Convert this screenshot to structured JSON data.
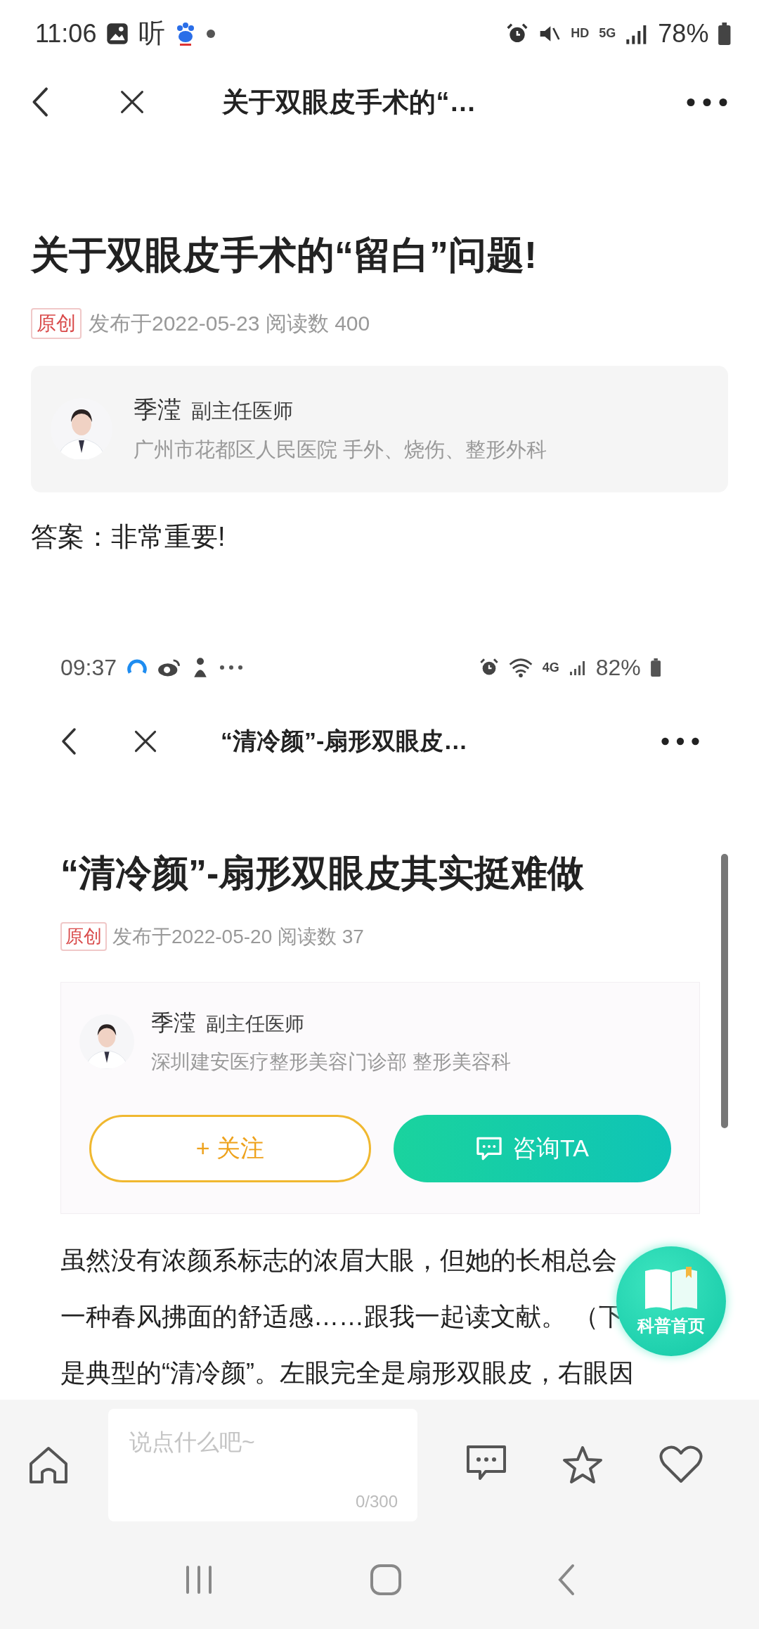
{
  "status_bar": {
    "time": "11:06",
    "app_glyph": "听",
    "network_labels": [
      "HD",
      "5G"
    ],
    "battery": "78%"
  },
  "nav": {
    "title": "关于双眼皮手术的“…"
  },
  "article": {
    "title": "关于双眼皮手术的“留白”问题!",
    "tag": "原创",
    "meta": "发布于2022-05-23 阅读数 400",
    "author": {
      "name": "季滢",
      "rank": "副主任医师",
      "hospital": "广州市花都区人民医院 手外、烧伤、整形外科"
    },
    "lead": "答案：非常重要!"
  },
  "embedded": {
    "status_bar": {
      "time": "09:37",
      "network_label": "4G",
      "battery": "82%"
    },
    "nav": {
      "title": "“清冷颜”-扇形双眼皮…"
    },
    "title": "“清冷颜”-扇形双眼皮其实挺难做",
    "tag": "原创",
    "meta": "发布于2022-05-20 阅读数 37",
    "author": {
      "name": "季滢",
      "rank": "副主任医师",
      "hospital": "深圳建安医疗整形美容门诊部 整形美容科"
    },
    "follow_button": "+ 关注",
    "consult_button": "咨询TA",
    "body_lines": [
      "虽然没有浓颜系标志的浓眉大眼，但她的长相总会",
      "一种春风拂面的舒适感……跟我一起读文献。 （下",
      "是典型的“清冷颜”。左眼完全是扇形双眼皮，右眼因"
    ]
  },
  "fab": {
    "label": "科普首页"
  },
  "bottom_bar": {
    "comment": {
      "placeholder": "说点什么吧~",
      "counter": "0/300"
    }
  }
}
